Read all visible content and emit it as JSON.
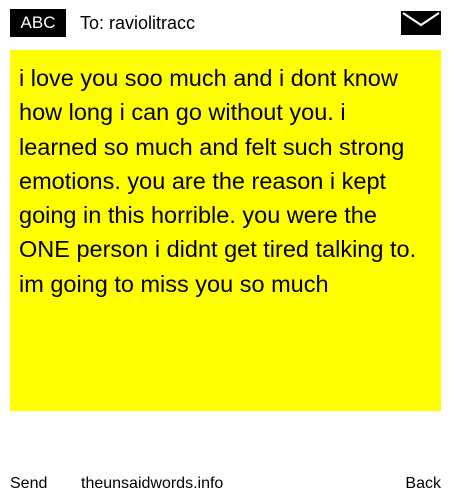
{
  "header": {
    "badge_label": "ABC",
    "to_text": "To: raviolitracc",
    "icon": "envelope-icon"
  },
  "message": {
    "background": "#ffff00",
    "text": "i love you soo much and i dont know how long i can go without you. i learned so much and felt such strong emotions. you are the reason i kept going in this horrible. you were the ONE person i didnt get tired talking to. im going to miss you so much"
  },
  "footer": {
    "send_label": "Send",
    "site_label": "theunsaidwords.info",
    "back_label": "Back"
  }
}
